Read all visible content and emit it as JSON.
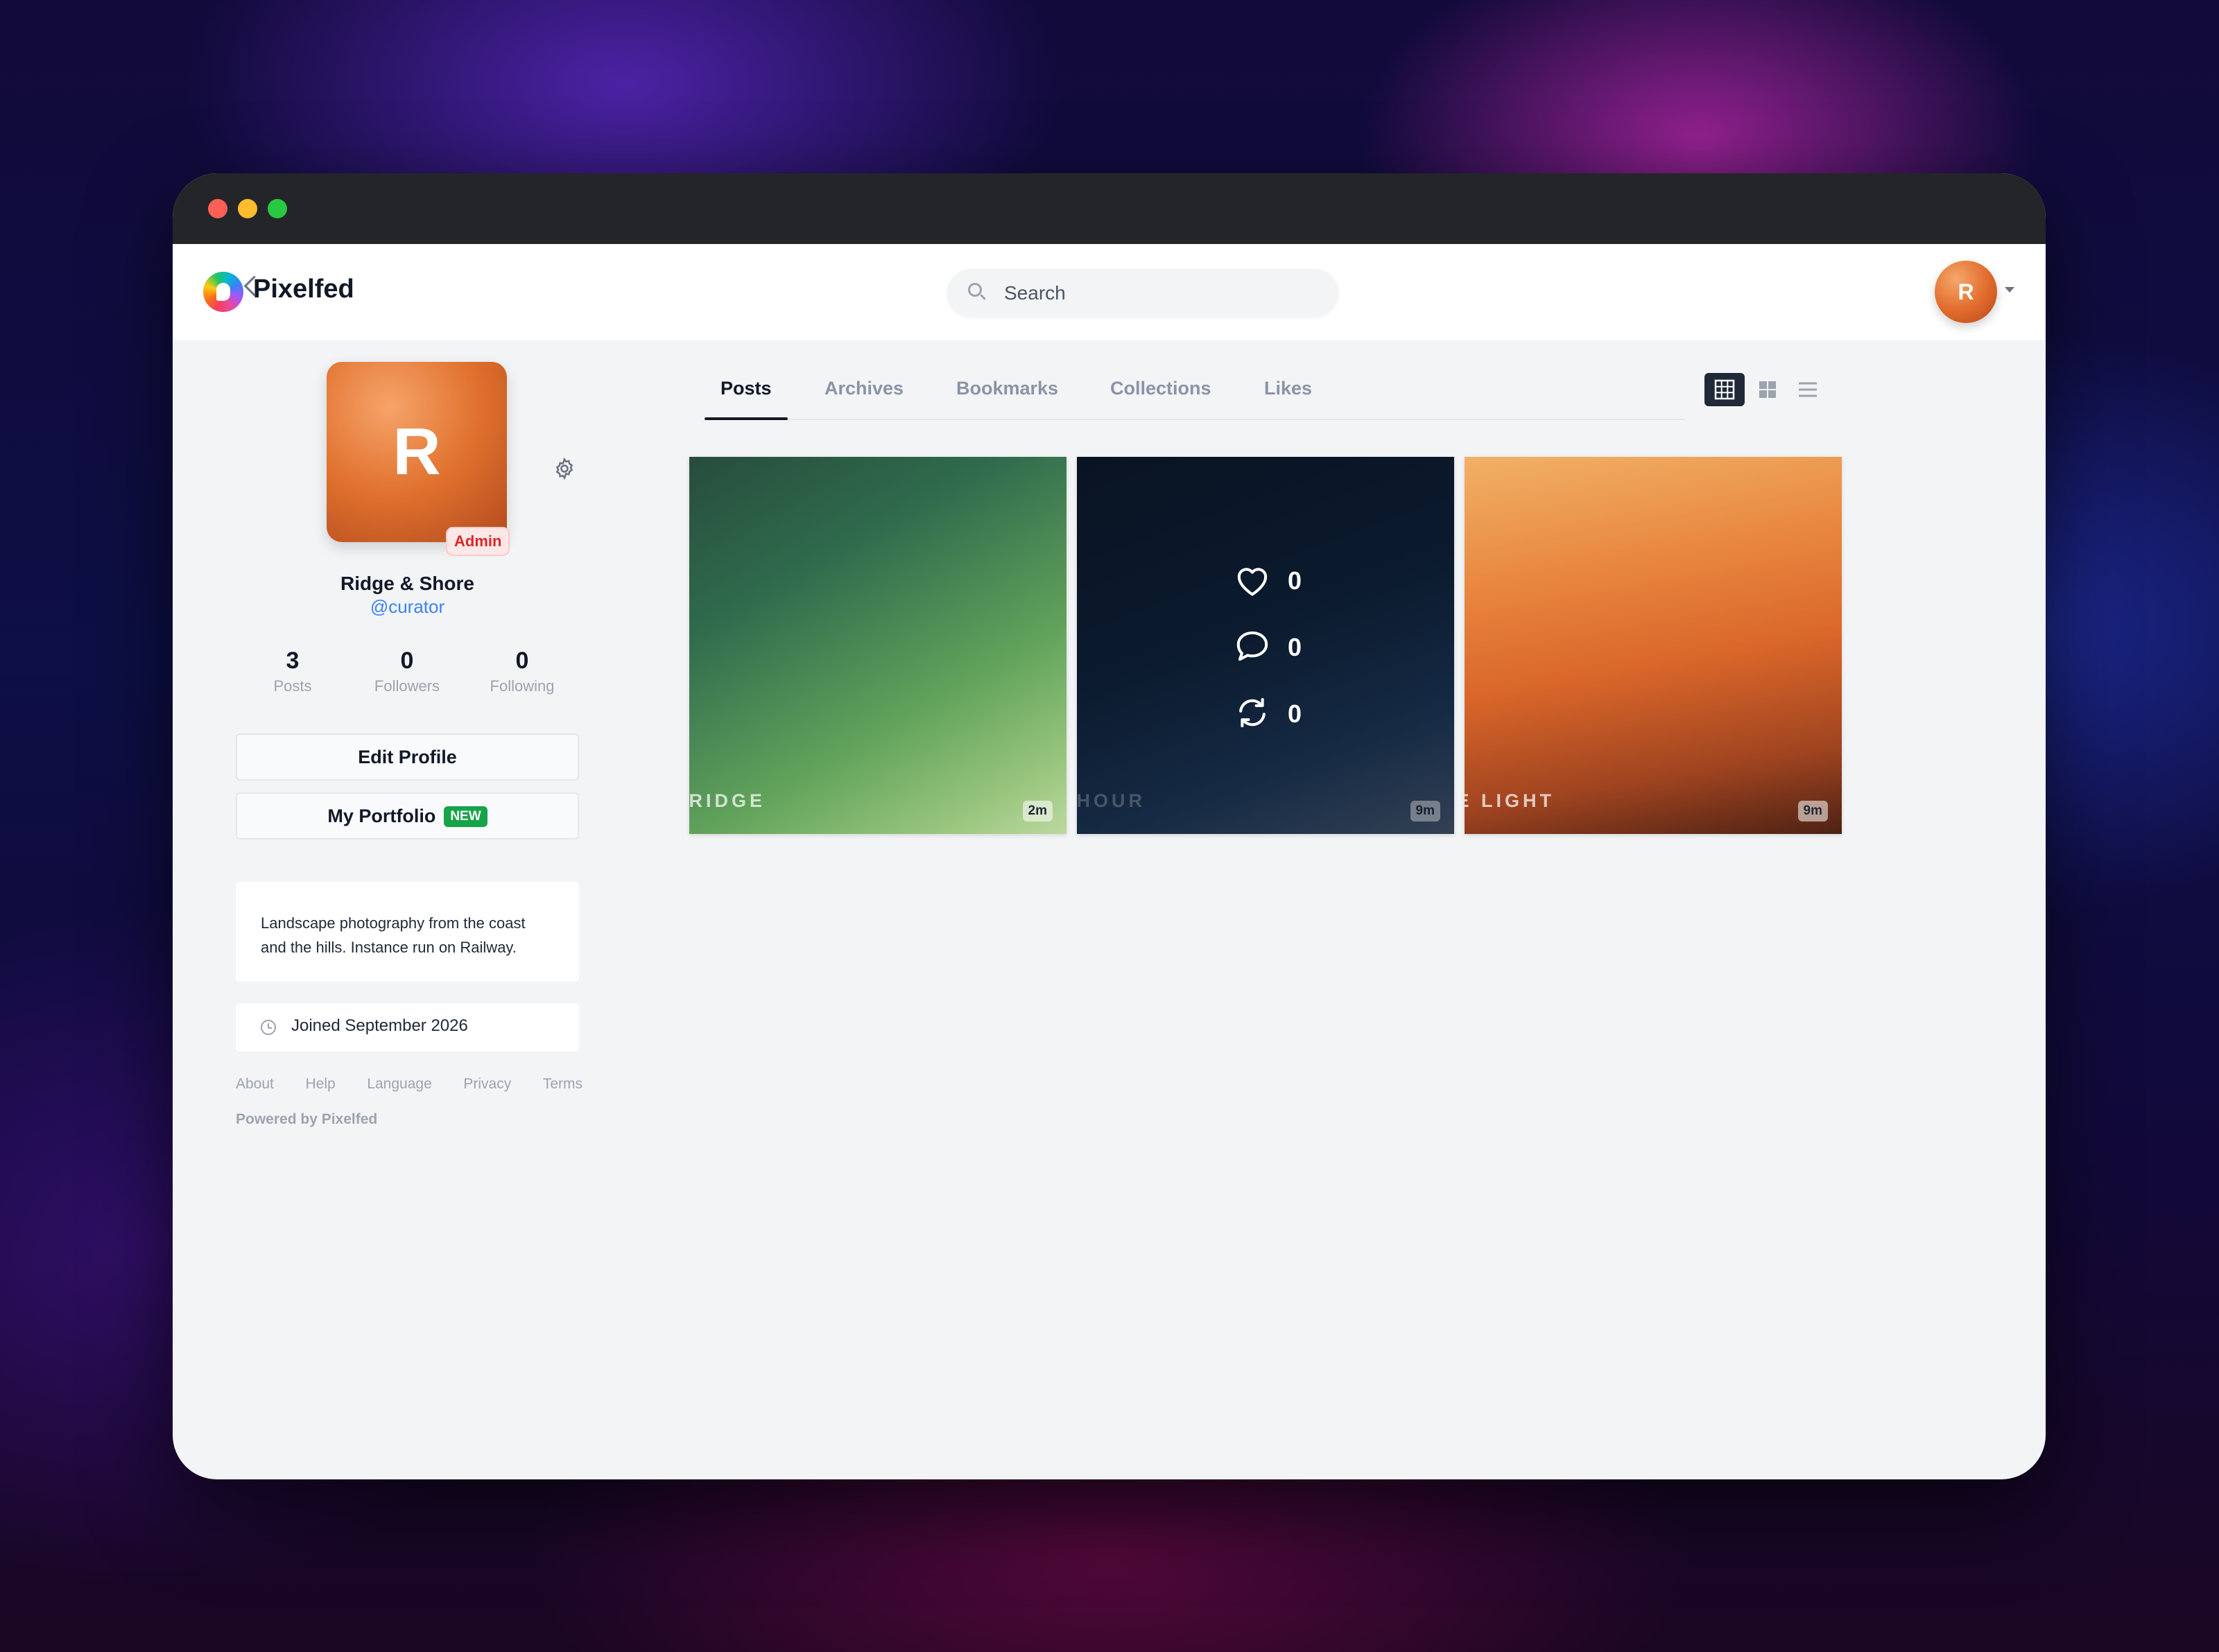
{
  "app": {
    "name": "Pixelfed",
    "search_placeholder": "Search",
    "user_initial": "R"
  },
  "profile": {
    "initial": "R",
    "badge": "Admin",
    "display_name": "Ridge & Shore",
    "handle": "@curator",
    "stats": [
      {
        "value": "3",
        "label": "Posts"
      },
      {
        "value": "0",
        "label": "Followers"
      },
      {
        "value": "0",
        "label": "Following"
      }
    ],
    "edit_label": "Edit Profile",
    "portfolio_label": "My Portfolio",
    "portfolio_badge": "NEW",
    "bio": "Landscape photography from the coast and the hills. Instance run on Railway.",
    "joined": "Joined September 2026"
  },
  "footer": {
    "links": [
      "About",
      "Help",
      "Language",
      "Privacy",
      "Terms"
    ],
    "powered": "Powered by Pixelfed"
  },
  "tabs": [
    "Posts",
    "Archives",
    "Bookmarks",
    "Collections",
    "Likes"
  ],
  "active_tab": "Posts",
  "posts": [
    {
      "title": "E RIDGE",
      "time": "2m"
    },
    {
      "title": "E HOUR",
      "time": "9m",
      "likes": "0",
      "comments": "0",
      "shares": "0"
    },
    {
      "title": "NE LIGHT",
      "time": "9m"
    }
  ],
  "colors": {
    "accent": "#3b82f6",
    "admin": "#dc2626",
    "new_badge": "#16a34a",
    "active_tab": "#111827"
  }
}
